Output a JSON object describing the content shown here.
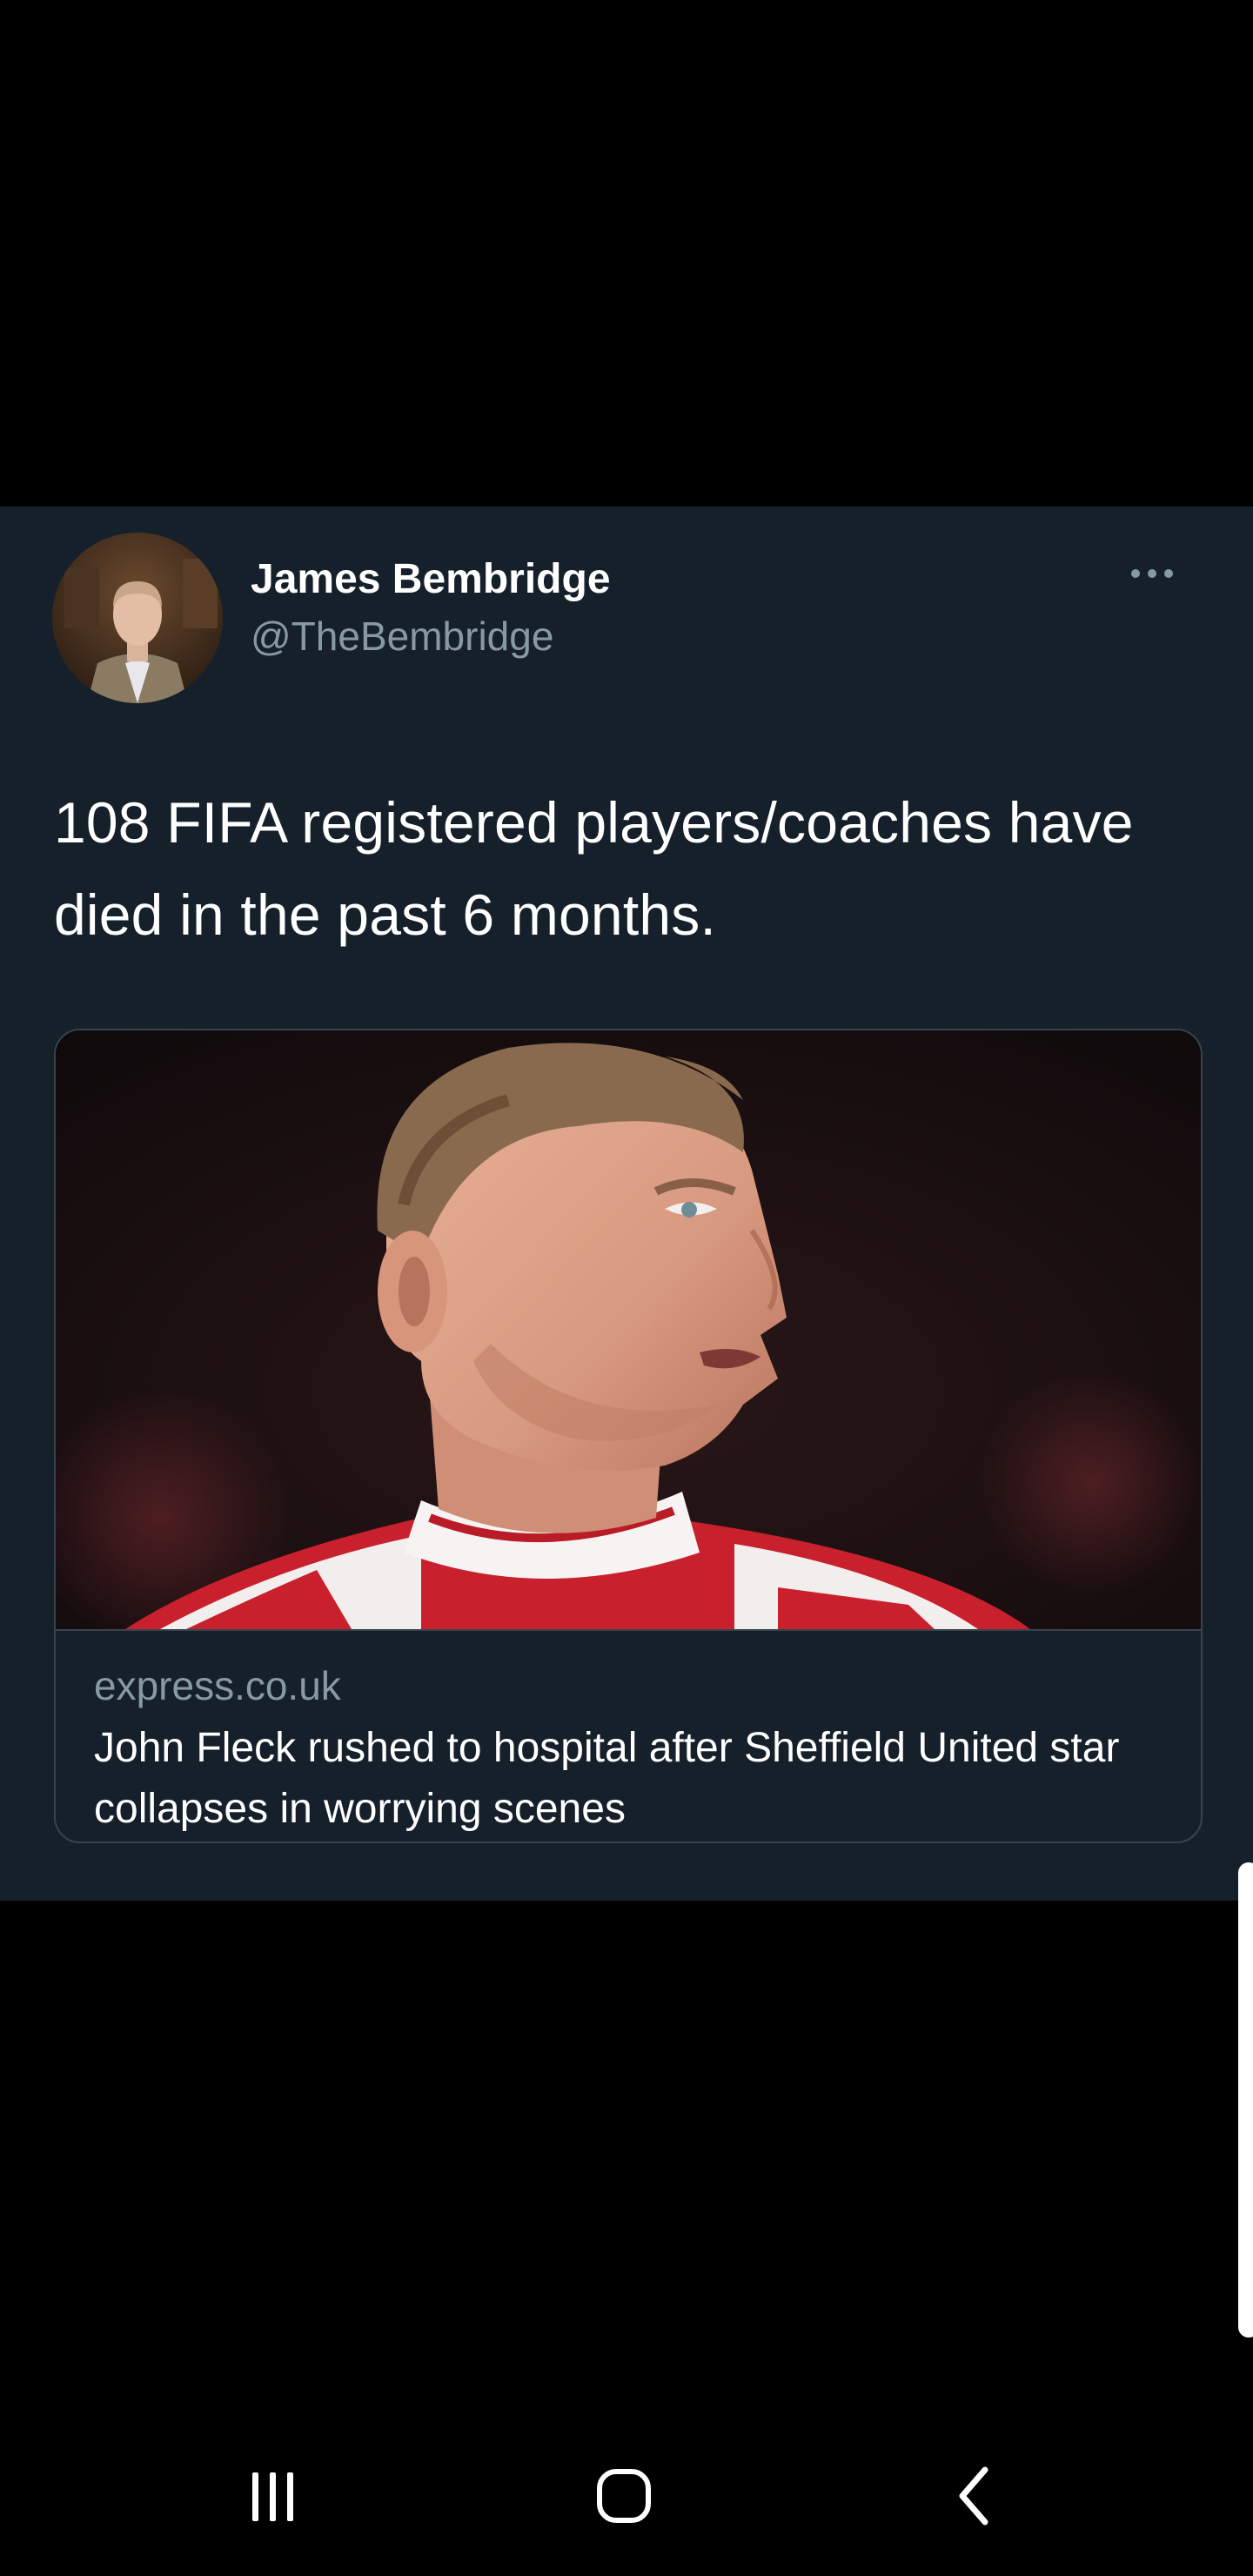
{
  "tweet": {
    "author": {
      "name": "James Bembridge",
      "handle": "@TheBembridge"
    },
    "more_icon": "more-horizontal-icon",
    "text": "108 FIFA registered players/coaches have died in the past 6 months.",
    "link_card": {
      "domain": "express.co.uk",
      "title": "John Fleck rushed to hospital after Sheffield United star collapses in worrying scenes"
    }
  },
  "navigation_bar": {
    "recents_icon": "recents-icon",
    "home_icon": "home-icon",
    "back_icon": "back-chevron-icon"
  },
  "colors": {
    "tweet_background": "#15202b",
    "primary_text": "#ffffff",
    "secondary_text": "#8899a6",
    "border": "#38444d",
    "screen_background": "#000000"
  }
}
